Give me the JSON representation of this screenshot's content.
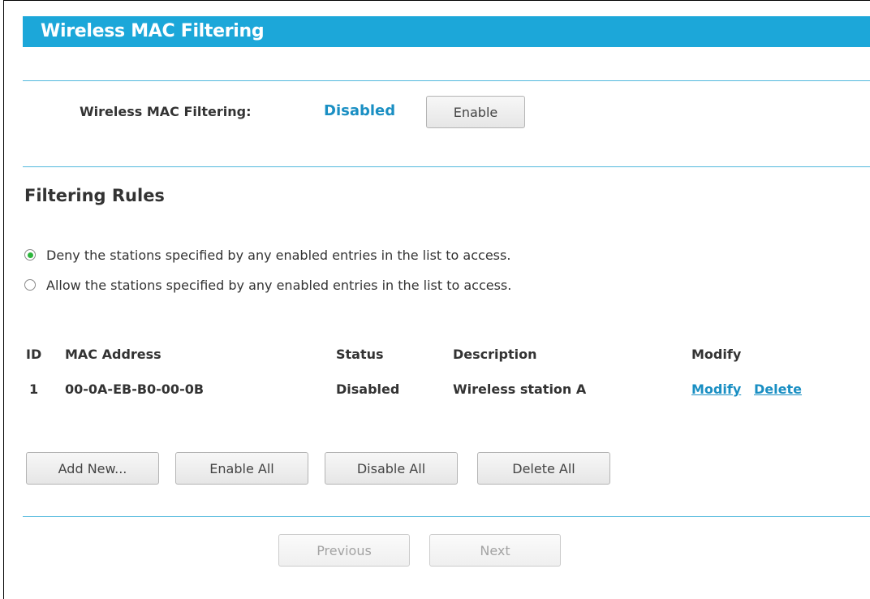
{
  "header": {
    "title": "Wireless MAC Filtering"
  },
  "filtering": {
    "label": "Wireless MAC Filtering:",
    "status": "Disabled",
    "enable_button": "Enable"
  },
  "rules": {
    "section_title": "Filtering Rules",
    "options": [
      {
        "label": "Deny the stations specified by any enabled entries in the list to access.",
        "selected": true
      },
      {
        "label": "Allow the stations specified by any enabled entries in the list to access.",
        "selected": false
      }
    ]
  },
  "table": {
    "headers": {
      "id": "ID",
      "mac": "MAC Address",
      "status": "Status",
      "description": "Description",
      "modify": "Modify"
    },
    "rows": [
      {
        "id": "1",
        "mac": "00-0A-EB-B0-00-0B",
        "status": "Disabled",
        "description": "Wireless station A",
        "modify_link": "Modify",
        "delete_link": "Delete"
      }
    ]
  },
  "actions": {
    "add_new": "Add New...",
    "enable_all": "Enable All",
    "disable_all": "Disable All",
    "delete_all": "Delete All"
  },
  "pagination": {
    "previous": "Previous",
    "next": "Next"
  },
  "colors": {
    "accent": "#1ca7d9",
    "link": "#1a8fc3",
    "radio_selected": "#2db53c"
  }
}
